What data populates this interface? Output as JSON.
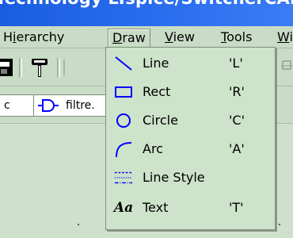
{
  "window": {
    "title": "Technology LTspice/SwitcherCAD III"
  },
  "menubar": {
    "items": [
      {
        "label": "Hierarchy",
        "access_key": "i"
      },
      {
        "label": "Draw",
        "access_key": "D"
      },
      {
        "label": "View",
        "access_key": "V"
      },
      {
        "label": "Tools",
        "access_key": "T"
      },
      {
        "label": "Wi",
        "access_key": "W"
      }
    ],
    "open_menu": "Draw"
  },
  "tabs": [
    {
      "label": "c"
    },
    {
      "label": "filtre."
    }
  ],
  "draw_menu": {
    "items": [
      {
        "icon": "line-icon",
        "label": "Line",
        "shortcut": "'L'"
      },
      {
        "icon": "rect-icon",
        "label": "Rect",
        "shortcut": "'R'"
      },
      {
        "icon": "circle-icon",
        "label": "Circle",
        "shortcut": "'C'"
      },
      {
        "icon": "arc-icon",
        "label": "Arc",
        "shortcut": "'A'"
      },
      {
        "icon": "line-style-icon",
        "label": "Line Style",
        "shortcut": ""
      },
      {
        "icon": "text-icon",
        "label": "Text",
        "shortcut": "'T'"
      }
    ],
    "icon_color": "#0000ff"
  }
}
